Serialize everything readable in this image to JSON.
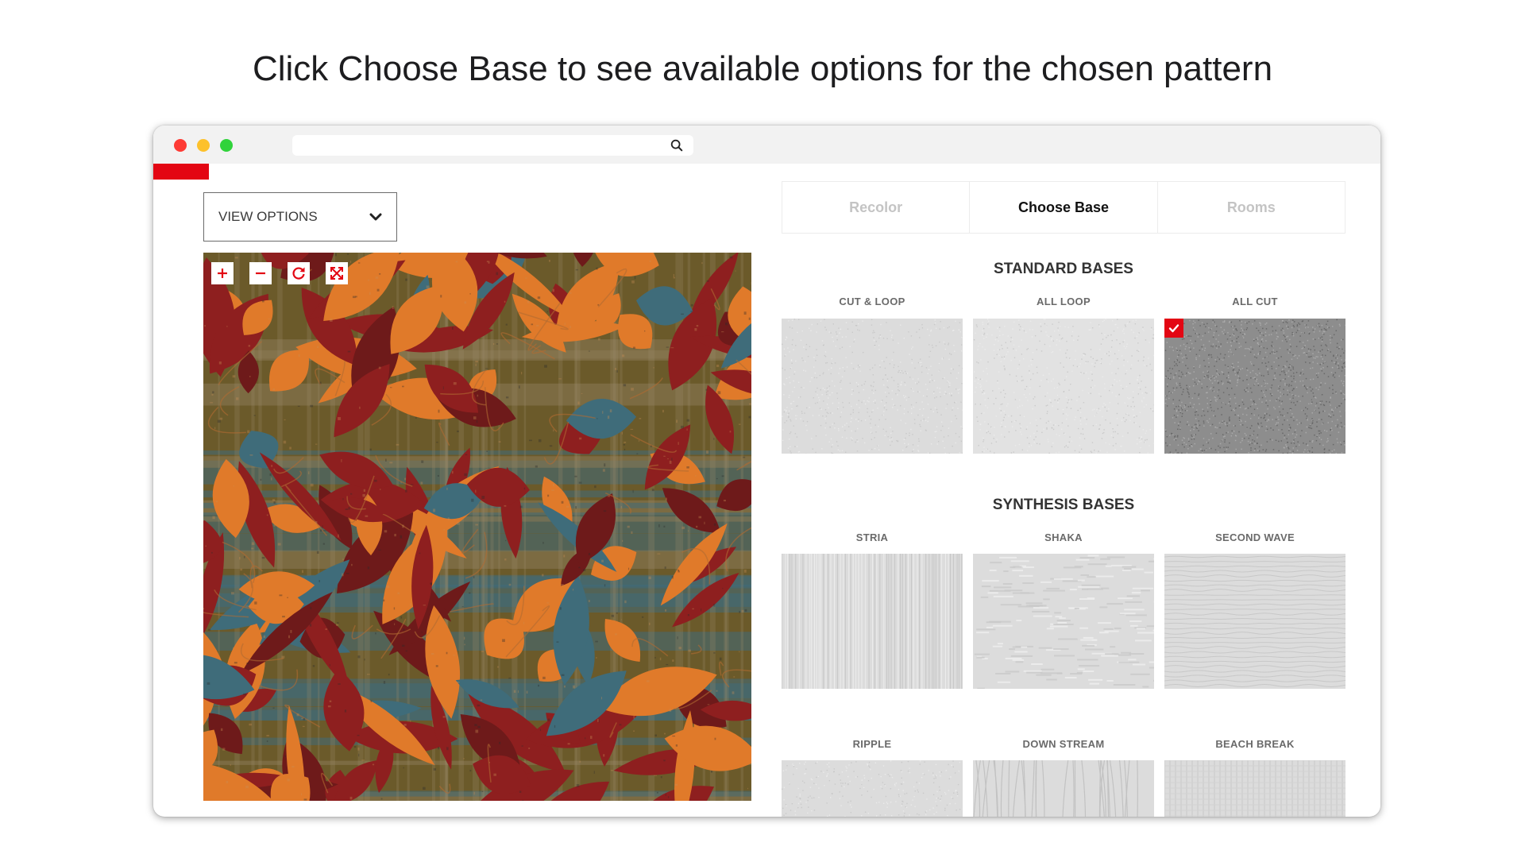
{
  "headline": "Click Choose Base to see available options for the chosen pattern",
  "view_options": {
    "label": "VIEW OPTIONS"
  },
  "tabs": [
    {
      "label": "Recolor",
      "active": false
    },
    {
      "label": "Choose Base",
      "active": true
    },
    {
      "label": "Rooms",
      "active": false
    }
  ],
  "standard_bases": {
    "title": "STANDARD BASES",
    "items": [
      {
        "label": "CUT & LOOP",
        "selected": false
      },
      {
        "label": "ALL LOOP",
        "selected": false
      },
      {
        "label": "ALL CUT",
        "selected": true
      }
    ]
  },
  "synthesis_bases": {
    "title": "SYNTHESIS BASES",
    "items": [
      {
        "label": "STRIA"
      },
      {
        "label": "SHAKA"
      },
      {
        "label": "SECOND WAVE"
      },
      {
        "label": "RIPPLE"
      },
      {
        "label": "DOWN STREAM"
      },
      {
        "label": "BEACH BREAK"
      }
    ]
  },
  "colors": {
    "brand_red": "#e30613",
    "pattern_orange": "#e07a2a",
    "pattern_red": "#8e1f1f",
    "pattern_teal": "#3f6c7a",
    "pattern_olive": "#6b5a2a"
  },
  "icons": {
    "zoom_in": "plus-icon",
    "zoom_out": "minus-icon",
    "rotate": "rotate-icon",
    "fullscreen": "expand-icon",
    "dropdown": "chevron-down-icon",
    "search": "search-icon",
    "selected": "checkmark-icon"
  }
}
